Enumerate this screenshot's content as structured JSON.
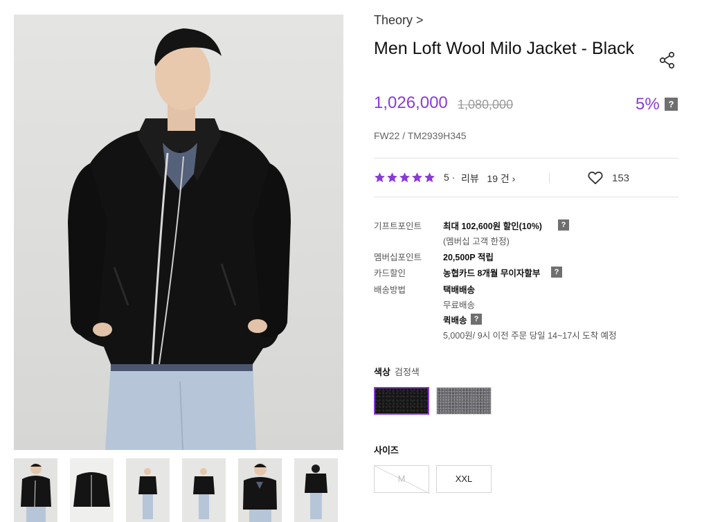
{
  "product": {
    "brand": "Theory >",
    "title": "Men Loft Wool Milo Jacket - Black",
    "price": "1,026,000",
    "original_price": "1,080,000",
    "discount": "5%",
    "help_glyph": "?",
    "sku": "FW22 / TM2939H345"
  },
  "rating": {
    "score": "5 ·",
    "review_link": "리뷰   19 건 ›",
    "stars": 5,
    "star_color": "#8a3ad8",
    "likes": "153"
  },
  "benefits": {
    "gift_label": "기프트포인트",
    "gift_value": "최대 102,600원 할인(10%)",
    "gift_note": "(멤버십 고객 한정)",
    "membership_label": "멤버십포인트",
    "membership_value": "20,500P 적립",
    "card_label": "카드할인",
    "card_value": "농협카드 8개월 무이자할부",
    "shipping_label": "배송방법",
    "shipping_value": "택배배송",
    "shipping_note": "무료배송",
    "quick_value": "퀵배송",
    "quick_note": "5,000원/ 9시 이전 주문 당일 14~17시 도착 예정"
  },
  "options": {
    "color_label": "색상",
    "color_selected": "검정색",
    "colors": [
      "black",
      "grey"
    ],
    "size_label": "사이즈",
    "sizes": [
      "M",
      "XXL"
    ],
    "sold_out_size": "M"
  },
  "theme": {
    "accent": "#8a3ad8",
    "help_box": "#6f6f6f"
  },
  "icons": {
    "share": "share-icon",
    "like": "heart-icon",
    "star": "star-icon"
  }
}
